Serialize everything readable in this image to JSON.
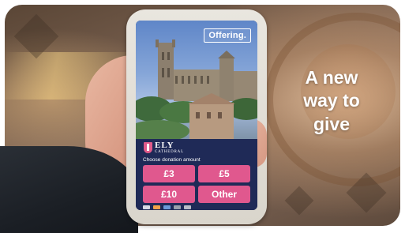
{
  "screen": {
    "badge": "Offering.",
    "brand": {
      "line1": "ELY",
      "line2": "CATHEDRAL"
    },
    "prompt": "Choose donation amount",
    "amounts": [
      "£3",
      "£5",
      "£10",
      "Other"
    ],
    "payment_icons": [
      "visa-icon",
      "mastercard-icon",
      "amex-icon",
      "apple-pay-icon",
      "google-pay-icon"
    ]
  },
  "tagline": {
    "line1": "A new",
    "line2": "way to",
    "line3": "give"
  },
  "colors": {
    "accent_pink": "#e0588e",
    "screen_navy": "#1f2a57",
    "tagline_text": "#ffffff"
  }
}
